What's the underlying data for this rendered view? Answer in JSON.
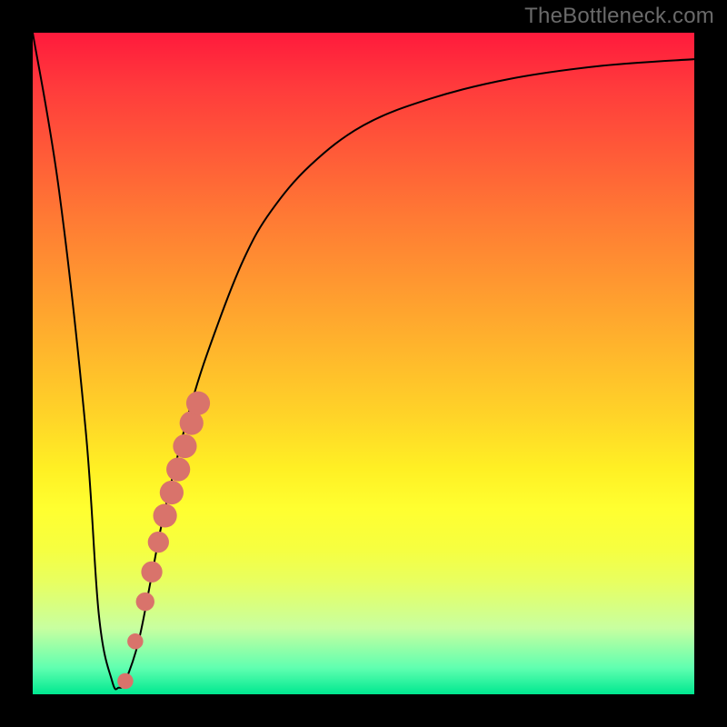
{
  "attribution": "TheBottleneck.com",
  "colors": {
    "curve": "#000000",
    "dots": "#d9736b",
    "frame": "#000000"
  },
  "chart_data": {
    "type": "line",
    "title": "",
    "xlabel": "",
    "ylabel": "",
    "xlim": [
      0,
      100
    ],
    "ylim": [
      0,
      100
    ],
    "series": [
      {
        "name": "bottleneck-curve",
        "x": [
          0,
          4,
          8,
          10,
          12,
          13,
          14,
          16,
          18,
          20,
          24,
          28,
          32,
          36,
          42,
          50,
          60,
          72,
          86,
          100
        ],
        "y": [
          100,
          76,
          40,
          12,
          2,
          1,
          2,
          8,
          18,
          28,
          44,
          56,
          66,
          73,
          80,
          86,
          90,
          93,
          95,
          96
        ]
      }
    ],
    "markers": [
      {
        "x": 14.0,
        "y": 2.0,
        "r": 1.2
      },
      {
        "x": 15.5,
        "y": 8.0,
        "r": 1.2
      },
      {
        "x": 17.0,
        "y": 14.0,
        "r": 1.4
      },
      {
        "x": 18.0,
        "y": 18.5,
        "r": 1.6
      },
      {
        "x": 19.0,
        "y": 23.0,
        "r": 1.6
      },
      {
        "x": 20.0,
        "y": 27.0,
        "r": 1.8
      },
      {
        "x": 21.0,
        "y": 30.5,
        "r": 1.8
      },
      {
        "x": 22.0,
        "y": 34.0,
        "r": 1.8
      },
      {
        "x": 23.0,
        "y": 37.5,
        "r": 1.8
      },
      {
        "x": 24.0,
        "y": 41.0,
        "r": 1.8
      },
      {
        "x": 25.0,
        "y": 44.0,
        "r": 1.8
      }
    ]
  }
}
